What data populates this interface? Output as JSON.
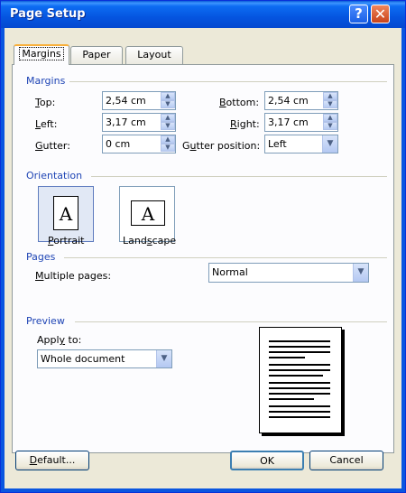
{
  "window": {
    "title": "Page Setup",
    "help_glyph": "?",
    "close_glyph": "✕"
  },
  "tabs": [
    {
      "label": "Margins"
    },
    {
      "label": "Paper"
    },
    {
      "label": "Layout"
    }
  ],
  "margins": {
    "section_label": "Margins",
    "top": {
      "label_key": "T",
      "label_rest": "op:",
      "value": "2,54 cm"
    },
    "bottom": {
      "label_key": "B",
      "label_rest": "ottom:",
      "value": "2,54 cm"
    },
    "left": {
      "label_key": "L",
      "label_rest": "eft:",
      "value": "3,17 cm"
    },
    "right": {
      "label_key": "R",
      "label_rest": "ight:",
      "value": "3,17 cm"
    },
    "gutter": {
      "label_key": "G",
      "label_rest": "utter:",
      "value": "0 cm"
    },
    "gutter_position": {
      "label_key": "u",
      "label_pre": "G",
      "label_rest": "tter position:",
      "value": "Left"
    }
  },
  "orientation": {
    "section_label": "Orientation",
    "portrait": {
      "label_key": "P",
      "label_rest": "ortrait",
      "glyph": "A",
      "selected": true
    },
    "landscape": {
      "label_pre": "Land",
      "label_key": "s",
      "label_rest": "cape",
      "glyph": "A",
      "selected": false
    }
  },
  "pages": {
    "section_label": "Pages",
    "multiple_pages": {
      "label_key": "M",
      "label_rest": "ultiple pages:",
      "value": "Normal"
    }
  },
  "preview": {
    "section_label": "Preview",
    "apply_to": {
      "label_pre": "Appl",
      "label_key": "y",
      "label_rest": " to:",
      "value": "Whole document"
    }
  },
  "buttons": {
    "default": {
      "label_key": "D",
      "label_rest": "efault..."
    },
    "ok": "OK",
    "cancel": "Cancel"
  },
  "colors": {
    "section_blue": "#1f45b5",
    "dialog_bg": "#ece9d8",
    "titlebar": "#0555e0"
  },
  "icons": {
    "spinner_up": "▲",
    "spinner_down": "▼",
    "combo": "▼"
  }
}
